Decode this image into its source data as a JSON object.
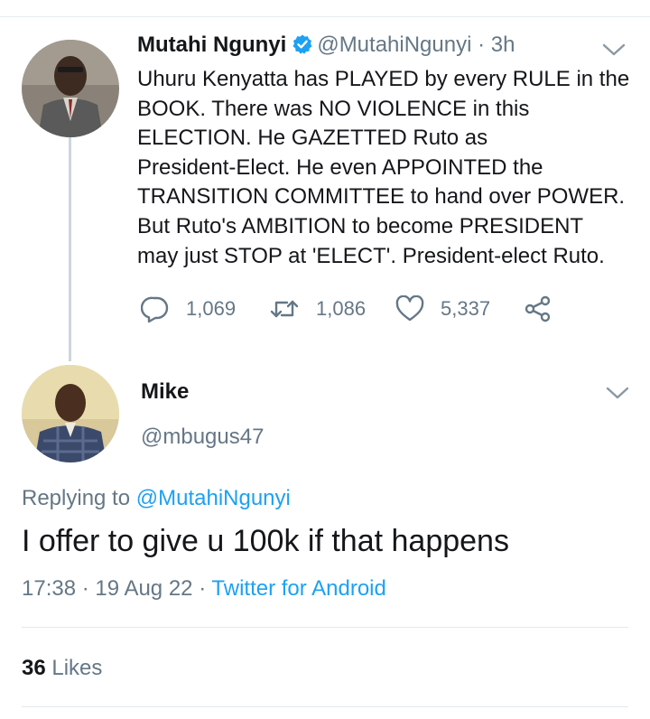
{
  "parent_tweet": {
    "name": "Mutahi Ngunyi",
    "handle": "@MutahiNgunyi",
    "separator": "·",
    "time": "3h",
    "text_lines": [
      "Uhuru Kenyatta has PLAYED by every RULE in the",
      "BOOK. There was NO VIOLENCE in this",
      "ELECTION. He GAZETTED Ruto as",
      "President-Elect. He even APPOINTED the",
      "TRANSITION COMMITTEE to hand over POWER.",
      "But Ruto's AMBITION to become PRESIDENT",
      "may just STOP at 'ELECT'. President-elect Ruto."
    ],
    "reply_count": "1,069",
    "retweet_count": "1,086",
    "like_count": "5,337",
    "icons": [
      "verified-badge-icon",
      "chevron-down-icon",
      "reply-icon",
      "retweet-icon",
      "heart-icon",
      "share-icon"
    ]
  },
  "reply_tweet": {
    "name": "Mike",
    "handle": "@mbugus47",
    "replying_prefix": "Replying to",
    "replying_to": "@MutahiNgunyi",
    "text": "I offer to give u 100k if that happens",
    "time": "17:38",
    "separator": "·",
    "date": "19 Aug 22",
    "separator2": "·",
    "source": "Twitter for Android",
    "likes_count": "36",
    "likes_label": "Likes"
  },
  "colors": {
    "accent": "#1da1f2",
    "text": "#14171a",
    "muted": "#657786",
    "divider": "#e1e8ed",
    "thread_line": "#ccd6dd"
  }
}
